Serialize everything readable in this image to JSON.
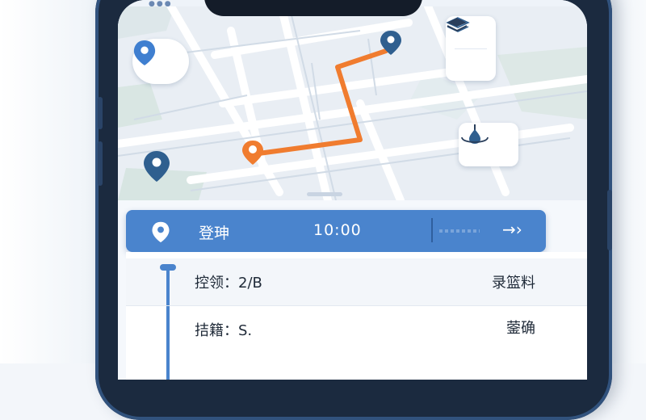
{
  "status": {
    "dots": "●●●"
  },
  "map": {
    "locate_icon": "location-pin-icon",
    "layers_icons": [
      "map-3d-icon",
      "layers-icon"
    ],
    "recenter_icon": "recenter-pin-icon",
    "colors": {
      "route": "#f07c2f",
      "pin": "#2f5f8f",
      "start_pin": "#f07c2f"
    }
  },
  "route_bar": {
    "label": "登珅",
    "time": "10:00",
    "arrow": "→›",
    "icon": "location-pin-icon",
    "color": "#4a84cd"
  },
  "details": [
    {
      "left": "控领：2/B",
      "right": "录篮料"
    },
    {
      "left": "拮籍：S.",
      "right": "蓥确"
    }
  ]
}
